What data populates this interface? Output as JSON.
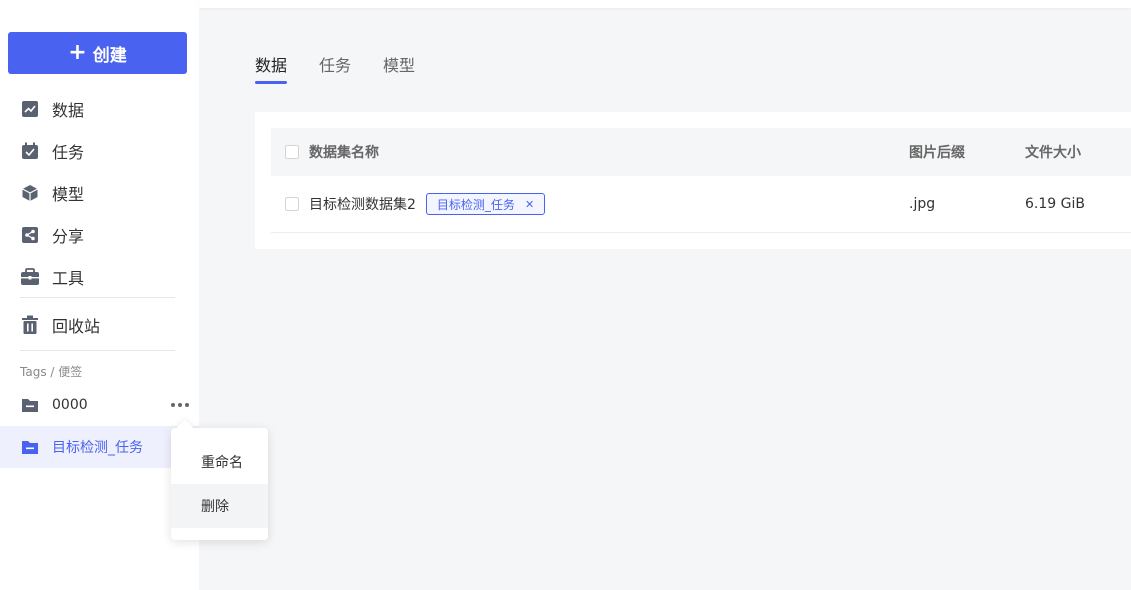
{
  "sidebar": {
    "create_label": "创建",
    "nav": [
      {
        "label": "数据",
        "icon": "chart-icon"
      },
      {
        "label": "任务",
        "icon": "task-icon"
      },
      {
        "label": "模型",
        "icon": "cube-icon"
      },
      {
        "label": "分享",
        "icon": "share-icon"
      },
      {
        "label": "工具",
        "icon": "toolbox-icon"
      }
    ],
    "trash_label": "回收站",
    "tags_title": "Tags / 便签",
    "tags": [
      {
        "label": "0000",
        "icon": "folder-icon"
      },
      {
        "label": "目标检测_任务",
        "icon": "folder-icon"
      }
    ]
  },
  "context_menu": {
    "items": [
      "重命名",
      "删除"
    ]
  },
  "main": {
    "tabs": [
      "数据",
      "任务",
      "模型"
    ],
    "table": {
      "headers": [
        "数据集名称",
        "图片后缀",
        "文件大小"
      ],
      "rows": [
        {
          "name": "目标检测数据集2",
          "tag": "目标检测_任务",
          "ext": ".jpg",
          "size": "6.19 GiB"
        }
      ]
    }
  },
  "colors": {
    "accent": "#4a62f0",
    "icon": "#5a6170"
  }
}
